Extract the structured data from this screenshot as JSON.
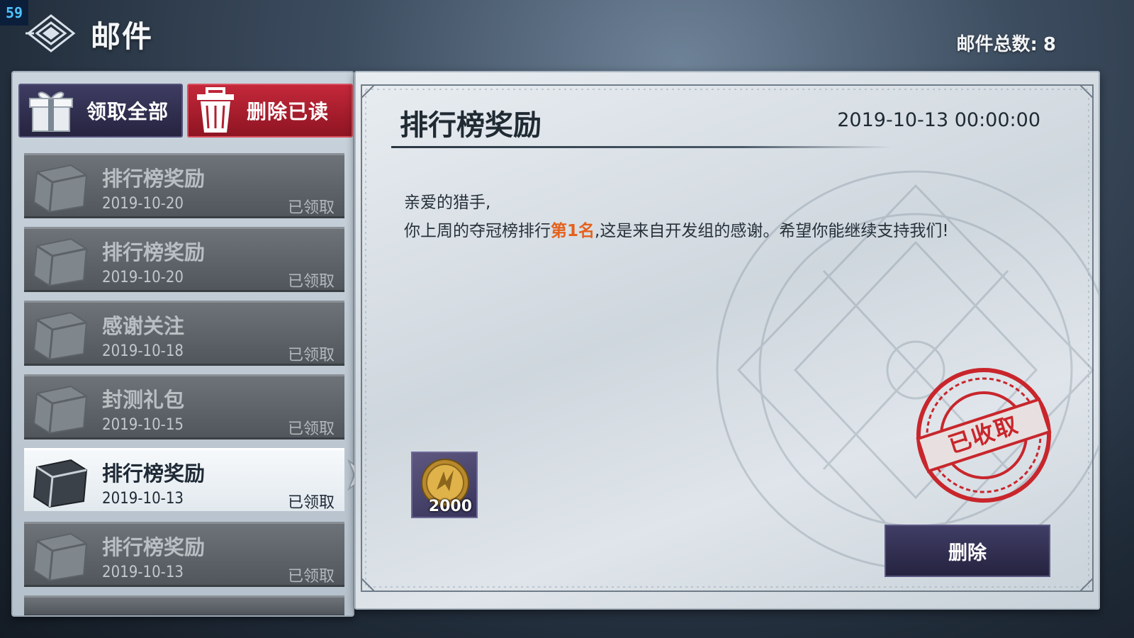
{
  "fps": "59",
  "header": {
    "title": "邮件",
    "total_label": "邮件总数:",
    "total_count": "8"
  },
  "actions": {
    "claim_all": "领取全部",
    "delete_read": "删除已读"
  },
  "mail_list": [
    {
      "title": "排行榜奖励",
      "date": "2019-10-20",
      "status": "已领取",
      "selected": false
    },
    {
      "title": "排行榜奖励",
      "date": "2019-10-20",
      "status": "已领取",
      "selected": false
    },
    {
      "title": "感谢关注",
      "date": "2019-10-18",
      "status": "已领取",
      "selected": false
    },
    {
      "title": "封测礼包",
      "date": "2019-10-15",
      "status": "已领取",
      "selected": false
    },
    {
      "title": "排行榜奖励",
      "date": "2019-10-13",
      "status": "已领取",
      "selected": true
    },
    {
      "title": "排行榜奖励",
      "date": "2019-10-13",
      "status": "已领取",
      "selected": false
    }
  ],
  "detail": {
    "title": "排行榜奖励",
    "time": "2019-10-13 00:00:00",
    "greeting": "亲爱的猎手,",
    "body_before": "你上周的夺冠榜排行",
    "body_highlight": "第1名",
    "body_after": ",这是来自开发组的感谢。希望你能继续支持我们!",
    "reward_amount": "2000",
    "reward_icon": "gold-coin-icon",
    "stamp_text": "已收取",
    "delete_label": "删除"
  },
  "colors": {
    "highlight": "#e5611d",
    "stamp": "#c8262c",
    "primary_button": "#2e2b4c",
    "danger_button": "#b01e30"
  }
}
